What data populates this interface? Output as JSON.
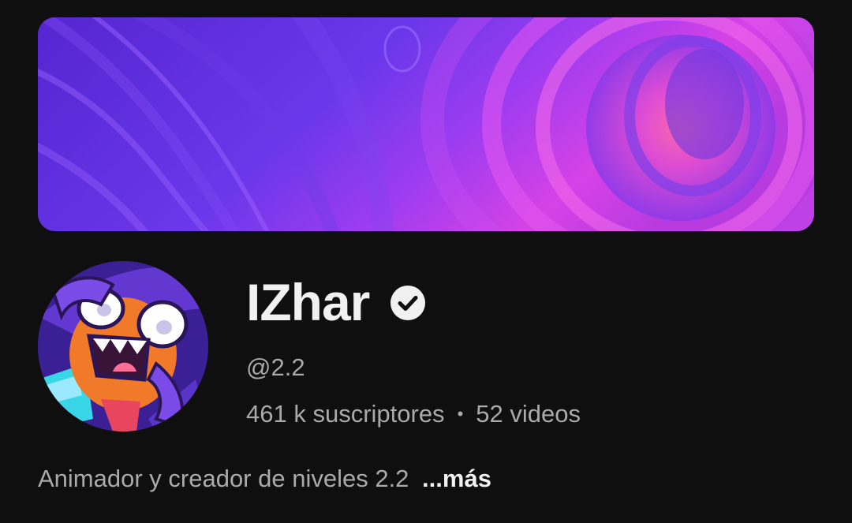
{
  "channel": {
    "name": "IZhar",
    "verified": true,
    "handle": "@2.2",
    "subscribers": "461 k suscriptores",
    "separator": "•",
    "videos": "52 videos",
    "description": "Animador y creador de niveles 2.2",
    "more_label": "...más"
  },
  "icons": {
    "verified": "verified-check-icon"
  },
  "colors": {
    "background": "#0f0f0f",
    "title": "#f1f1f1",
    "secondary_text": "#aaaaaa",
    "banner_primary": "#6a35e8",
    "banner_accent": "#d93fe0"
  }
}
